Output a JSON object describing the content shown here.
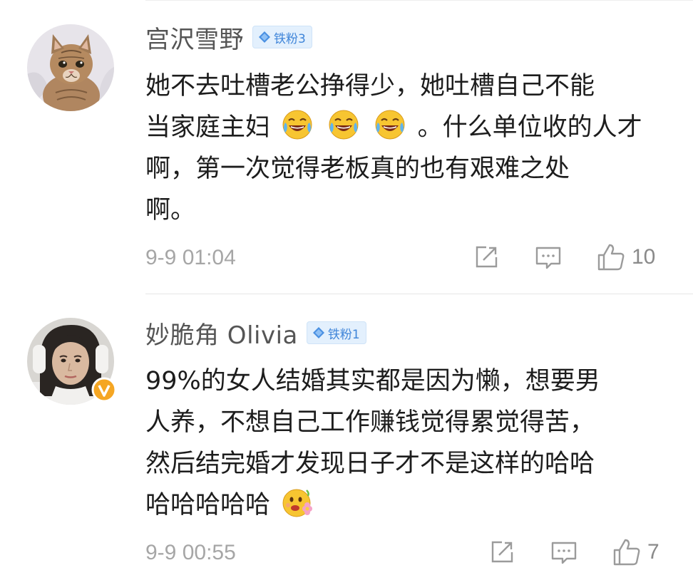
{
  "comments": [
    {
      "username": "宫沢雪野",
      "badge": "铁粉3",
      "content_lines": [
        "她不去吐槽老公挣得少，她吐槽自己不能",
        "当家庭主妇",
        "。什么单位收的人才",
        "啊，第一次觉得老板真的也有艰难之处",
        "啊。"
      ],
      "time": "9-9 01:04",
      "likes": "10",
      "emojis": [
        "laugh-cry-emoji",
        "laugh-cry-emoji",
        "laugh-cry-emoji"
      ]
    },
    {
      "username": "妙脆角 Olivia",
      "badge": "铁粉1",
      "content_lines": [
        "99%的女人结婚其实都是因为懒，想要男",
        "人养，不想自己工作赚钱觉得累觉得苦，",
        "然后结完婚才发现日子才不是这样的哈哈",
        "哈哈哈哈哈"
      ],
      "time": "9-9 00:55",
      "likes": "7",
      "emojis": [
        "flower-face-emoji"
      ],
      "verified": true
    }
  ],
  "colors": {
    "badge_text": "#3f85d9",
    "badge_bg": "#e3f0fd",
    "meta_text": "#a6a6a6",
    "verified": "#f5a623"
  }
}
